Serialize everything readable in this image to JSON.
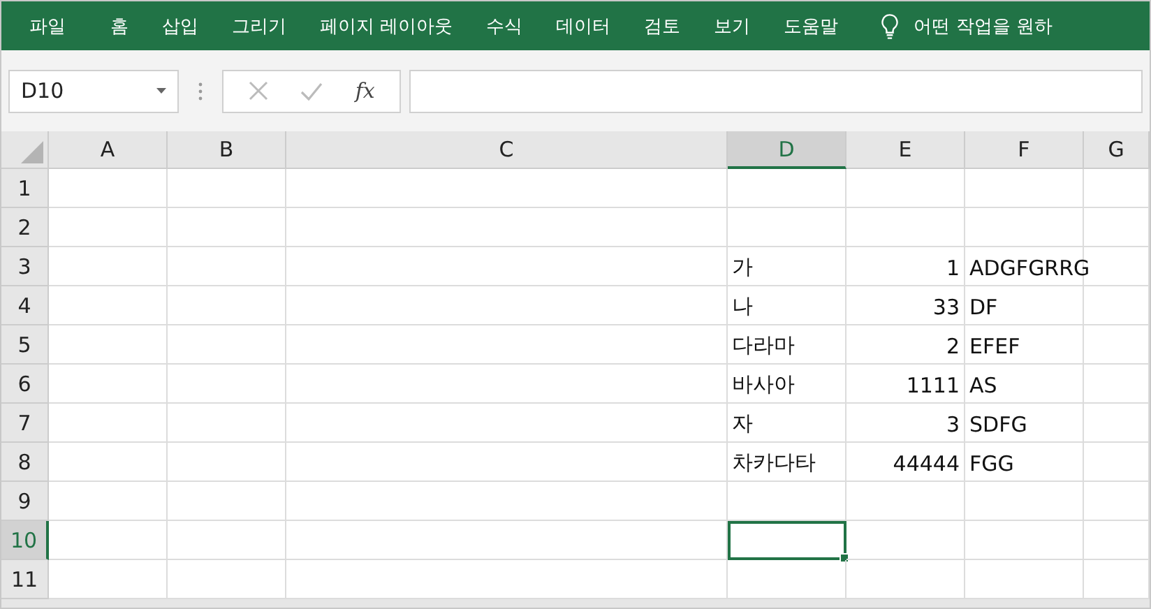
{
  "menu": {
    "items": [
      "파일",
      "홈",
      "삽입",
      "그리기",
      "페이지 레이아웃",
      "수식",
      "데이터",
      "검토",
      "보기",
      "도움말"
    ],
    "search": {
      "placeholder": "어떤 작업을 원하"
    }
  },
  "formula_bar": {
    "name_box": "D10",
    "function_label": "fx",
    "cancel_disabled": true,
    "enter_disabled": true
  },
  "columns": [
    {
      "label": "A",
      "selected": false
    },
    {
      "label": "B",
      "selected": false
    },
    {
      "label": "C",
      "selected": false
    },
    {
      "label": "D",
      "selected": true
    },
    {
      "label": "E",
      "selected": false
    },
    {
      "label": "F",
      "selected": false
    },
    {
      "label": "G",
      "selected": false
    }
  ],
  "rows": [
    {
      "header": "1",
      "selected": false,
      "cells": [
        {
          "selected": false
        },
        {
          "selected": false
        },
        {
          "selected": false
        },
        {
          "selected": false
        },
        {
          "selected": false
        },
        {
          "selected": false
        },
        {
          "selected": false
        }
      ]
    },
    {
      "header": "2",
      "selected": false,
      "cells": [
        {
          "selected": false
        },
        {
          "selected": false
        },
        {
          "selected": false
        },
        {
          "selected": false
        },
        {
          "selected": false
        },
        {
          "selected": false
        },
        {
          "selected": false
        }
      ]
    },
    {
      "header": "3",
      "selected": false,
      "cells": [
        {
          "selected": false
        },
        {
          "selected": false
        },
        {
          "selected": false
        },
        {
          "selected": false,
          "kind": "text",
          "value": "가"
        },
        {
          "selected": false,
          "kind": "number",
          "value": "1"
        },
        {
          "selected": false,
          "kind": "text",
          "value": "ADGFGRRG"
        },
        {
          "selected": false
        }
      ]
    },
    {
      "header": "4",
      "selected": false,
      "cells": [
        {
          "selected": false
        },
        {
          "selected": false
        },
        {
          "selected": false
        },
        {
          "selected": false,
          "kind": "text",
          "value": "나"
        },
        {
          "selected": false,
          "kind": "number",
          "value": "33"
        },
        {
          "selected": false,
          "kind": "text",
          "value": "DF"
        },
        {
          "selected": false
        }
      ]
    },
    {
      "header": "5",
      "selected": false,
      "cells": [
        {
          "selected": false
        },
        {
          "selected": false
        },
        {
          "selected": false
        },
        {
          "selected": false,
          "kind": "text",
          "value": "다라마"
        },
        {
          "selected": false,
          "kind": "number",
          "value": "2"
        },
        {
          "selected": false,
          "kind": "text",
          "value": "EFEF"
        },
        {
          "selected": false
        }
      ]
    },
    {
      "header": "6",
      "selected": false,
      "cells": [
        {
          "selected": false
        },
        {
          "selected": false
        },
        {
          "selected": false
        },
        {
          "selected": false,
          "kind": "text",
          "value": "바사아"
        },
        {
          "selected": false,
          "kind": "number",
          "value": "1111"
        },
        {
          "selected": false,
          "kind": "text",
          "value": "AS"
        },
        {
          "selected": false
        }
      ]
    },
    {
      "header": "7",
      "selected": false,
      "cells": [
        {
          "selected": false
        },
        {
          "selected": false
        },
        {
          "selected": false
        },
        {
          "selected": false,
          "kind": "text",
          "value": "자"
        },
        {
          "selected": false,
          "kind": "number",
          "value": "3"
        },
        {
          "selected": false,
          "kind": "text",
          "value": "SDFG"
        },
        {
          "selected": false
        }
      ]
    },
    {
      "header": "8",
      "selected": false,
      "cells": [
        {
          "selected": false
        },
        {
          "selected": false
        },
        {
          "selected": false
        },
        {
          "selected": false,
          "kind": "text",
          "value": "차카다타"
        },
        {
          "selected": false,
          "kind": "number",
          "value": "44444"
        },
        {
          "selected": false,
          "kind": "text",
          "value": "FGG"
        },
        {
          "selected": false
        }
      ]
    },
    {
      "header": "9",
      "selected": false,
      "cells": [
        {
          "selected": false
        },
        {
          "selected": false
        },
        {
          "selected": false
        },
        {
          "selected": false
        },
        {
          "selected": false
        },
        {
          "selected": false
        },
        {
          "selected": false
        }
      ]
    },
    {
      "header": "10",
      "selected": true,
      "cells": [
        {
          "selected": false
        },
        {
          "selected": false
        },
        {
          "selected": false
        },
        {
          "selected": true
        },
        {
          "selected": false
        },
        {
          "selected": false
        },
        {
          "selected": false
        }
      ]
    },
    {
      "header": "11",
      "selected": false,
      "cells": [
        {
          "selected": false
        },
        {
          "selected": false
        },
        {
          "selected": false
        },
        {
          "selected": false
        },
        {
          "selected": false
        },
        {
          "selected": false
        },
        {
          "selected": false
        }
      ]
    }
  ]
}
